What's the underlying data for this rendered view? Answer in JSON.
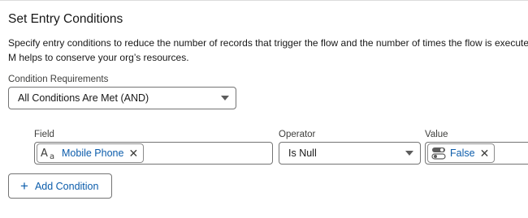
{
  "section": {
    "title": "Set Entry Conditions",
    "description": "Specify entry conditions to reduce the number of records that trigger the flow and the number of times the flow is executed. M helps to conserve your org’s resources."
  },
  "condition_requirements": {
    "label": "Condition Requirements",
    "selected": "All Conditions Are Met (AND)"
  },
  "condition_row": {
    "field_label": "Field",
    "field_value": "Mobile Phone",
    "field_icon": "text-field-icon",
    "operator_label": "Operator",
    "operator_value": "Is Null",
    "value_label": "Value",
    "value_value": "False",
    "value_icon": "boolean-toggle-icon"
  },
  "add_condition": {
    "label": "Add Condition",
    "icon": "plus-icon"
  },
  "colors": {
    "link_blue": "#0b5cab",
    "border": "#747474",
    "text": "#181818"
  }
}
